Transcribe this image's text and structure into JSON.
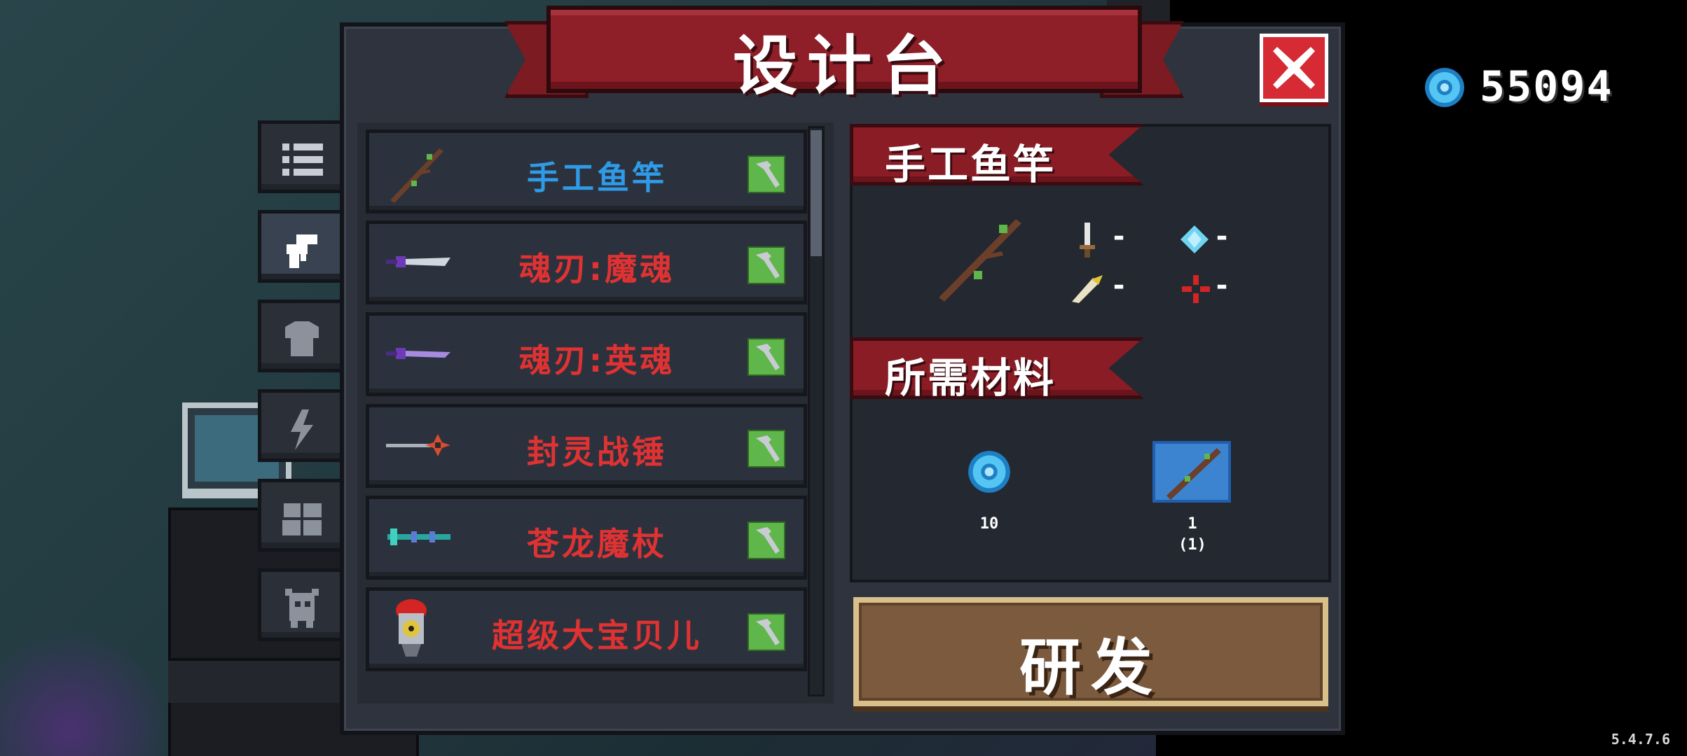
{
  "window": {
    "title": "设计台",
    "version": "5.4.7.6"
  },
  "currency": {
    "gems": "55094",
    "icon": "gem-icon"
  },
  "tabs": [
    {
      "icon": "list-icon",
      "active": false
    },
    {
      "icon": "weapon-icon",
      "active": true
    },
    {
      "icon": "armor-icon",
      "active": false
    },
    {
      "icon": "lightning-icon",
      "active": false
    },
    {
      "icon": "statue-icon",
      "active": false
    },
    {
      "icon": "pet-icon",
      "active": false
    }
  ],
  "items": [
    {
      "name": "手工鱼竿",
      "color": "#2f9be8",
      "icon": "fishing-rod-icon"
    },
    {
      "name": "魂刃:魔魂",
      "color": "#e03232",
      "icon": "sword-icon"
    },
    {
      "name": "魂刃:英魂",
      "color": "#e03232",
      "icon": "sword-icon"
    },
    {
      "name": "封灵战锤",
      "color": "#e03232",
      "icon": "warhammer-icon"
    },
    {
      "name": "苍龙魔杖",
      "color": "#e03232",
      "icon": "staff-icon"
    },
    {
      "name": "超级大宝贝儿",
      "color": "#e03232",
      "icon": "nuke-bomb-icon"
    }
  ],
  "detail": {
    "name": "手工鱼竿",
    "stats": {
      "damage": "-",
      "energy": "-",
      "crit": "-",
      "accuracy": "-"
    },
    "materials_title": "所需材料",
    "materials": [
      {
        "icon": "gem-icon",
        "count": "10",
        "owned": ""
      },
      {
        "icon": "blueprint-icon",
        "count": "1",
        "owned": "(1)"
      }
    ]
  },
  "actions": {
    "develop": "研发",
    "close_icon": "close-icon"
  },
  "colors": {
    "banner_red": "#8e1e27",
    "rare_red": "#e03232",
    "common_blue": "#2f9be8",
    "hammer_green": "#5fb64a",
    "button_brown": "#7c5a3d"
  }
}
